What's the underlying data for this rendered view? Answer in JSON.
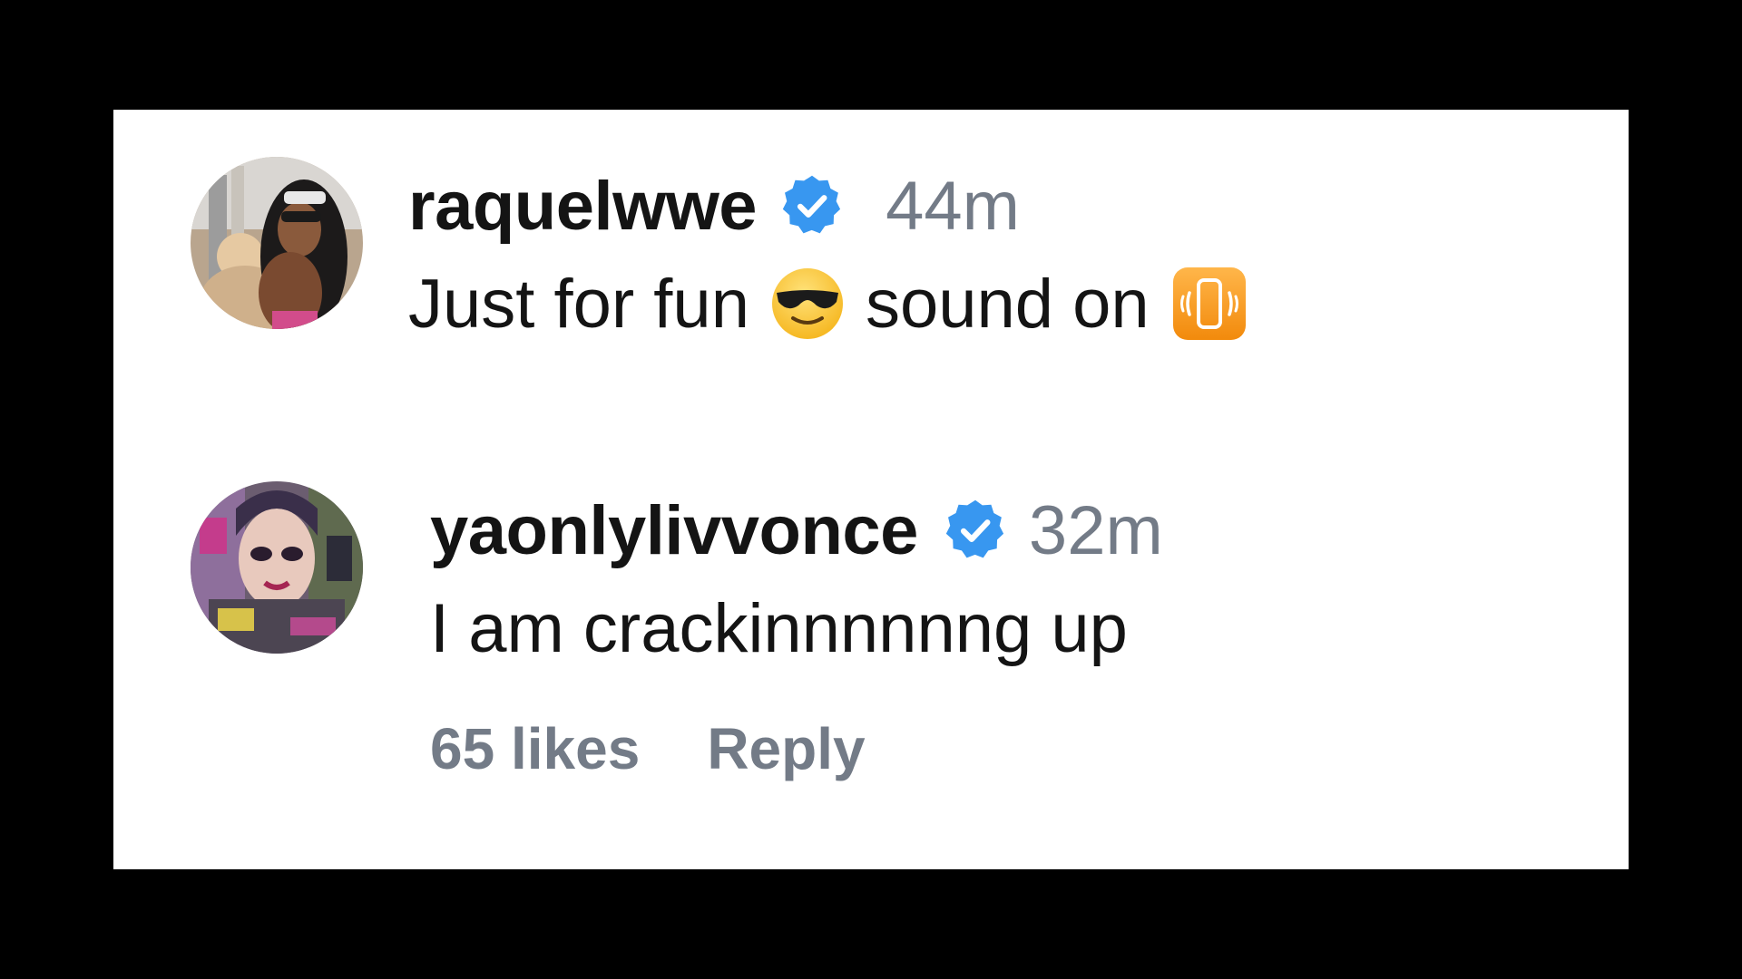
{
  "comments": [
    {
      "username": "raquelwwe",
      "verified": true,
      "time": "44m",
      "text_before_emoji": "Just for fun",
      "emoji_1": "smiling-face-with-sunglasses",
      "text_after_emoji": "sound on",
      "emoji_2": "vibration-mode"
    },
    {
      "username": "yaonlylivvonce",
      "verified": true,
      "time": "32m",
      "text": "I am crackinnnnnng up"
    }
  ],
  "actions": {
    "likes": "65 likes",
    "reply": "Reply"
  },
  "colors": {
    "background": "#000000",
    "card": "#ffffff",
    "text": "#141414",
    "muted": "#737b87",
    "verified": "#3897f0",
    "phone_emoji": "#f7941d"
  }
}
